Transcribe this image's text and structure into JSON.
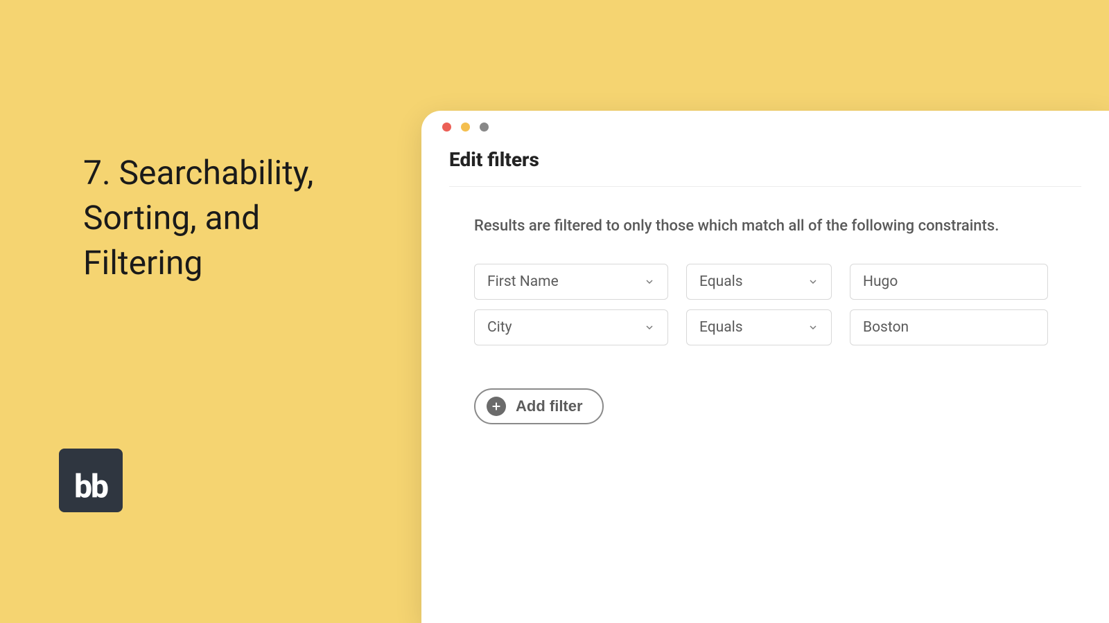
{
  "slide": {
    "title": "7. Searchability, Sorting, and Filtering",
    "logo_text": "bb"
  },
  "window": {
    "panel_title": "Edit filters",
    "description": "Results are filtered to only those which match all of the following constraints.",
    "filters": [
      {
        "field": "First Name",
        "operator": "Equals",
        "value": "Hugo"
      },
      {
        "field": "City",
        "operator": "Equals",
        "value": "Boston"
      }
    ],
    "add_filter_label": "Add filter"
  }
}
